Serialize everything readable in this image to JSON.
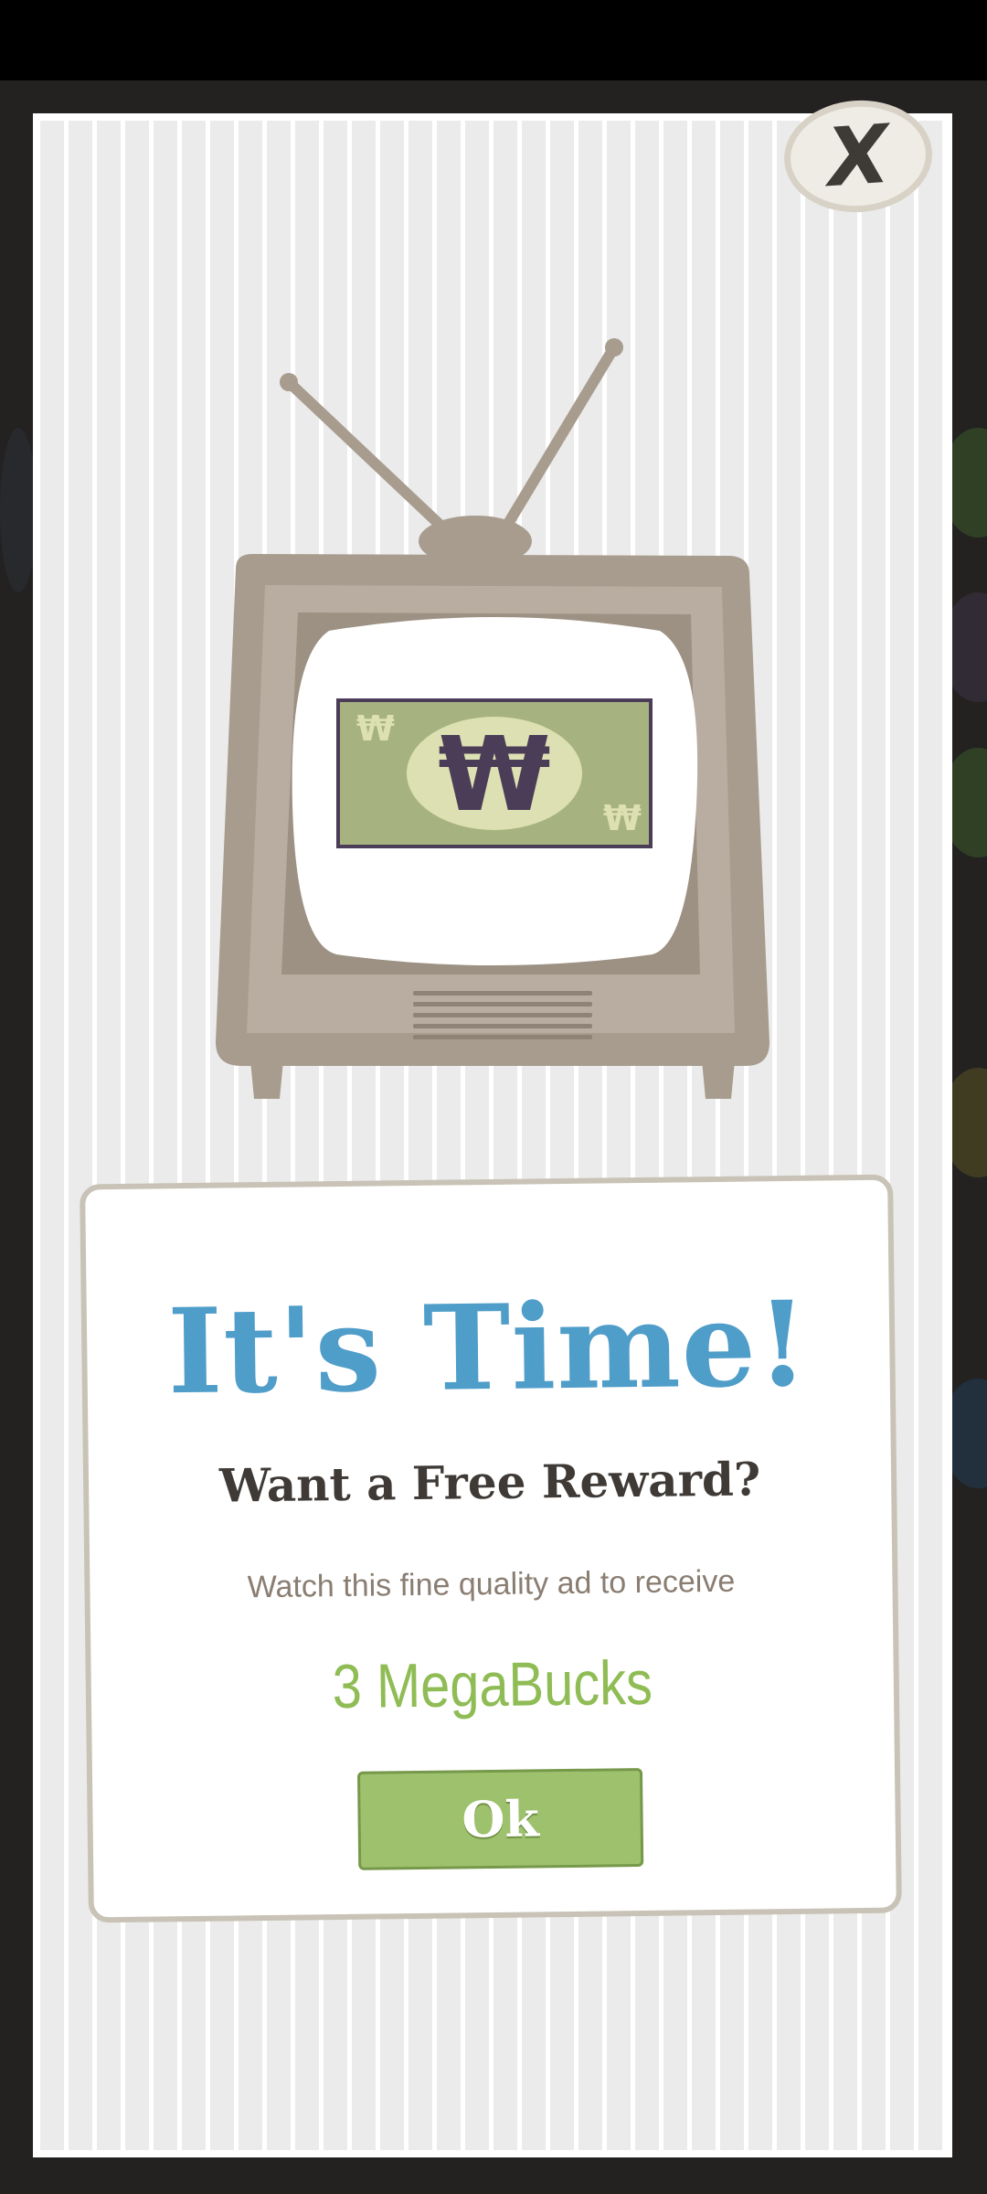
{
  "colors": {
    "title": "#4f9dc9",
    "reward": "#8fbc55",
    "button": "#9dc16c",
    "tv_body": "#b0a597",
    "bill": "#a6b27f",
    "bill_symbol": "#4b3d58"
  },
  "modal": {
    "close_label": "X",
    "close_icon": "close-icon",
    "tv_icon": "tv-icon",
    "currency_symbol": "₩",
    "title": "It's Time!",
    "subtitle": "Want a Free Reward?",
    "description": "Watch this fine quality ad to receive",
    "reward": "3 MegaBucks",
    "ok_label": "Ok"
  }
}
